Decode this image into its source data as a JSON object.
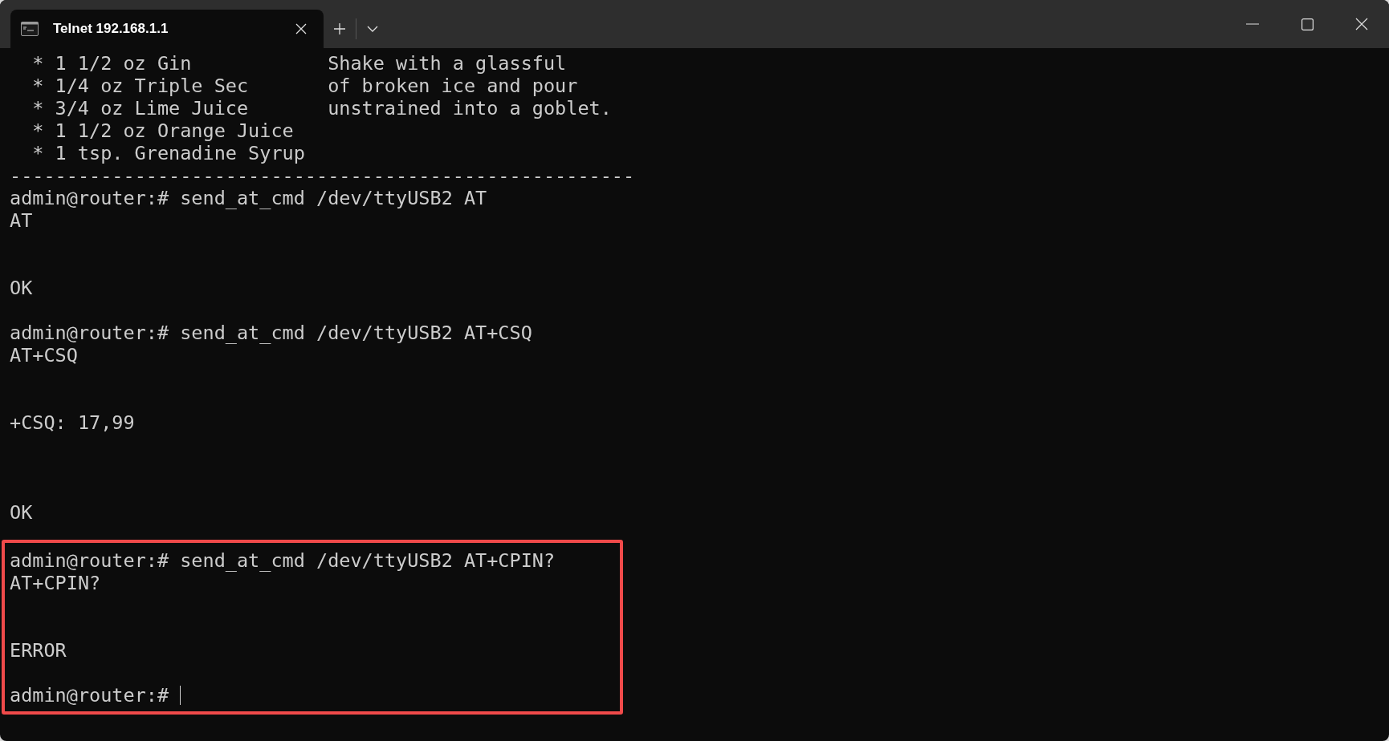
{
  "tabs": [
    {
      "title": "Telnet 192.168.1.1",
      "selected": true
    }
  ],
  "terminal": {
    "lines": [
      {
        "kind": "columns",
        "left": "* 1 1/2 oz Gin",
        "right": "Shake with a glassful"
      },
      {
        "kind": "columns",
        "left": "* 1/4 oz Triple Sec",
        "right": "of broken ice and pour"
      },
      {
        "kind": "columns",
        "left": "* 3/4 oz Lime Juice",
        "right": "unstrained into a goblet."
      },
      {
        "kind": "columns",
        "left": "* 1 1/2 oz Orange Juice"
      },
      {
        "kind": "columns",
        "left": "* 1 tsp. Grenadine Syrup"
      },
      {
        "kind": "rule",
        "text": "-------------------------------------------------------"
      },
      {
        "kind": "prompt",
        "prompt": "admin@router:#",
        "command": "send_at_cmd /dev/ttyUSB2 AT"
      },
      {
        "kind": "output",
        "text": "AT"
      },
      {
        "kind": "blank"
      },
      {
        "kind": "blank"
      },
      {
        "kind": "output",
        "text": "OK"
      },
      {
        "kind": "blank"
      },
      {
        "kind": "prompt",
        "prompt": "admin@router:#",
        "command": "send_at_cmd /dev/ttyUSB2 AT+CSQ"
      },
      {
        "kind": "output",
        "text": "AT+CSQ"
      },
      {
        "kind": "blank"
      },
      {
        "kind": "blank"
      },
      {
        "kind": "output",
        "text": "+CSQ: 17,99"
      },
      {
        "kind": "blank"
      },
      {
        "kind": "blank"
      },
      {
        "kind": "blank"
      },
      {
        "kind": "output",
        "text": "OK"
      }
    ],
    "highlighted_block": {
      "lines": [
        {
          "kind": "prompt",
          "prompt": "admin@router:#",
          "command": "send_at_cmd /dev/ttyUSB2 AT+CPIN?"
        },
        {
          "kind": "output",
          "text": "AT+CPIN?"
        },
        {
          "kind": "blank"
        },
        {
          "kind": "blank"
        },
        {
          "kind": "output",
          "text": "ERROR"
        },
        {
          "kind": "blank"
        },
        {
          "kind": "prompt",
          "prompt": "admin@router:#",
          "cursor": true
        }
      ]
    }
  }
}
